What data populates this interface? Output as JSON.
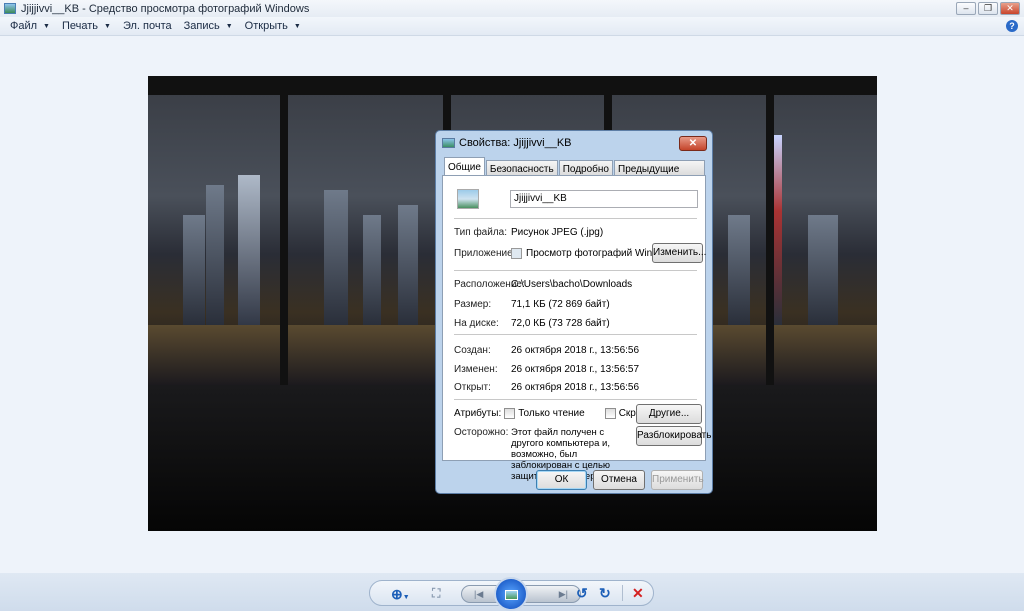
{
  "window": {
    "title": "Jjijjivvi__KB - Средство просмотра фотографий Windows"
  },
  "menu": [
    {
      "label": "Файл",
      "dropdown": true
    },
    {
      "label": "Печать",
      "dropdown": true
    },
    {
      "label": "Эл. почта",
      "dropdown": false
    },
    {
      "label": "Запись",
      "dropdown": true
    },
    {
      "label": "Открыть",
      "dropdown": true
    }
  ],
  "help": "?",
  "dialog": {
    "title": "Свойства: Jjijjivvi__KB",
    "tabs": [
      "Общие",
      "Безопасность",
      "Подробно",
      "Предыдущие версии"
    ],
    "filename": "Jjijjivvi__KB",
    "file_type_label": "Тип файла:",
    "file_type": "Рисунок JPEG (.jpg)",
    "app_label": "Приложение:",
    "app": "Просмотр фотографий Windows",
    "change_btn": "Изменить...",
    "location_label": "Расположение:",
    "location": "C:\\Users\\bacho\\Downloads",
    "size_label": "Размер:",
    "size": "71,1 КБ (72 869 байт)",
    "disk_label": "На диске:",
    "disk": "72,0 КБ (73 728 байт)",
    "created_label": "Создан:",
    "created": "26 октября 2018 г., 13:56:56",
    "modified_label": "Изменен:",
    "modified": "26 октября 2018 г., 13:56:57",
    "opened_label": "Открыт:",
    "opened": "26 октября 2018 г., 13:56:56",
    "attributes_label": "Атрибуты:",
    "readonly": "Только чтение",
    "hidden": "Скрытый",
    "other_btn": "Другие...",
    "caution_label": "Осторожно:",
    "caution_text": "Этот файл получен с другого компьютера и, возможно, был заблокирован с целью защиты компьютера.",
    "unblock_btn": "Разблокировать",
    "ok": "ОК",
    "cancel": "Отмена",
    "apply": "Применить"
  }
}
